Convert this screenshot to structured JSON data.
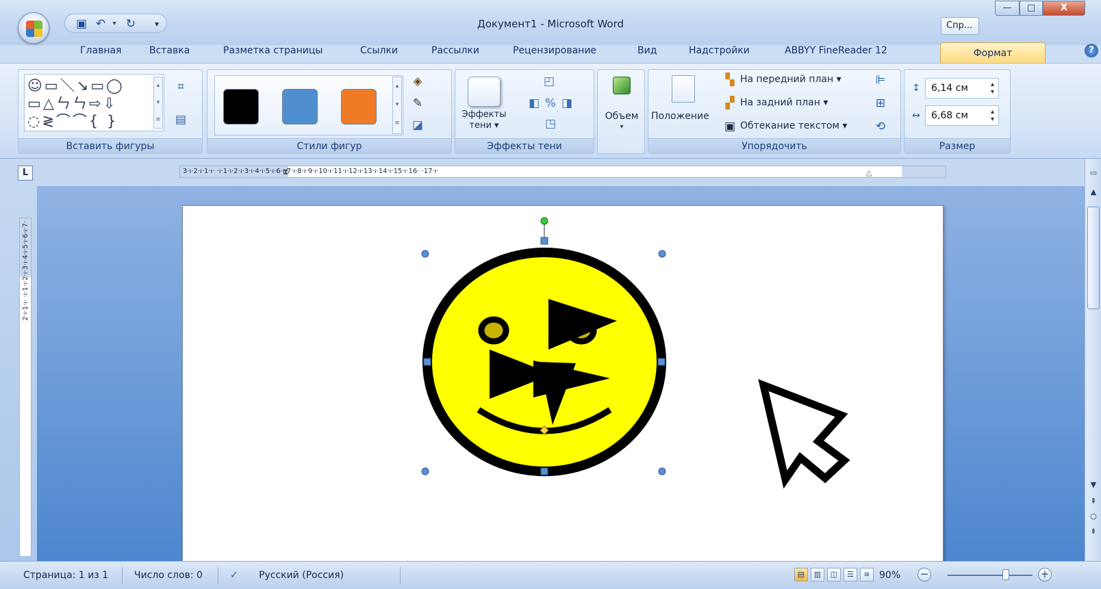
{
  "window": {
    "title": "Документ1 - Microsoft Word",
    "help_button": "Спр...",
    "close_label": "X",
    "minimize_label": "—",
    "maximize_label": "□"
  },
  "tabs": [
    "Главная",
    "Вставка",
    "Разметка страницы",
    "Ссылки",
    "Рассылки",
    "Рецензирование",
    "Вид",
    "Надстройки",
    "ABBYY FineReader 12"
  ],
  "active_tab": "Формат",
  "ribbon": {
    "insert_shapes": {
      "label": "Вставить фигуры",
      "rows": [
        "☺▭＼↘▭◯",
        "▭△ㄣㄣ⇨⇩",
        "◌≷⌒⌒{ }"
      ]
    },
    "shape_styles": {
      "label": "Стили фигур",
      "swatches": [
        "#000000",
        "#4f8fd0",
        "#ef7b26"
      ]
    },
    "shadow_effects": {
      "label": "Эффекты тени",
      "button": "Эффекты тени ▾",
      "button_line1": "Эффекты",
      "button_line2": "тени ▾"
    },
    "volume": {
      "label": "Объем",
      "arrow": "▾"
    },
    "arrange": {
      "label": "Упорядочить",
      "position": "Положение",
      "bring_front": "На передний план ▾",
      "send_back": "На задний план ▾",
      "text_wrap": "Обтекание текстом ▾"
    },
    "size": {
      "label": "Размер",
      "height": "6,14 см",
      "width": "6,68 см"
    }
  },
  "ruler": {
    "horizontal": "3·ı·2·ı·1·ı· ·ı·1·ı·2·ı·3·ı·4·ı·5·ı·6·ı·7·ı·8·ı·9·ı·10·ı·11·ı·12·ı·13·ı·14·ı·15·ı·16· ·17·ı·",
    "vertical": "2·ı·1·ı· ·ı·1·ı·2·ı·3·ı·4·ı·5·ı·6·ı·7·"
  },
  "status": {
    "page": "Страница: 1 из 1",
    "words": "Число слов: 0",
    "language": "Русский (Россия)",
    "zoom": "90%"
  },
  "colors": {
    "smiley_fill": "#ffff00",
    "eye_fill": "#c8b400",
    "active_tab": "#ffd97a"
  }
}
